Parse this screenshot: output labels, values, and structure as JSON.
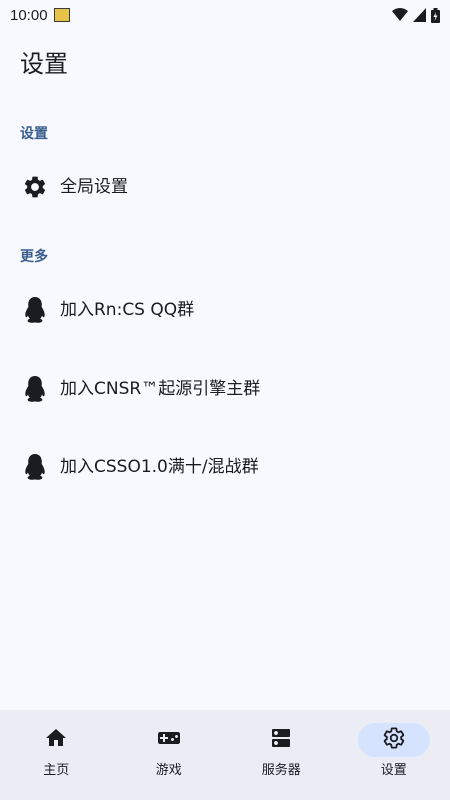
{
  "status_bar": {
    "time": "10:00",
    "icons": [
      "app-notification-icon",
      "wifi-icon",
      "signal-icon",
      "battery-icon"
    ]
  },
  "app_bar": {
    "title": "设置"
  },
  "sections": {
    "settings": {
      "header": "设置",
      "items": [
        {
          "label": "全局设置",
          "icon": "gear-icon"
        }
      ]
    },
    "more": {
      "header": "更多",
      "items": [
        {
          "label": "加入Rn:CS QQ群",
          "icon": "qq-penguin-icon"
        },
        {
          "label": "加入CNSR™起源引擎主群",
          "icon": "qq-penguin-icon"
        },
        {
          "label": "加入CSSO1.0满十/混战群",
          "icon": "qq-penguin-icon"
        }
      ]
    }
  },
  "bottom_nav": {
    "items": [
      {
        "label": "主页",
        "icon": "home-icon",
        "active": false
      },
      {
        "label": "游戏",
        "icon": "gamepad-icon",
        "active": false
      },
      {
        "label": "服务器",
        "icon": "server-icon",
        "active": false
      },
      {
        "label": "设置",
        "icon": "gear-icon",
        "active": true
      }
    ]
  },
  "colors": {
    "background": "#f8f9ff",
    "accent": "#3a5f8f",
    "nav_background": "#ecedf4",
    "nav_active_pill": "#d6e3ff",
    "text": "#1b1c20"
  }
}
